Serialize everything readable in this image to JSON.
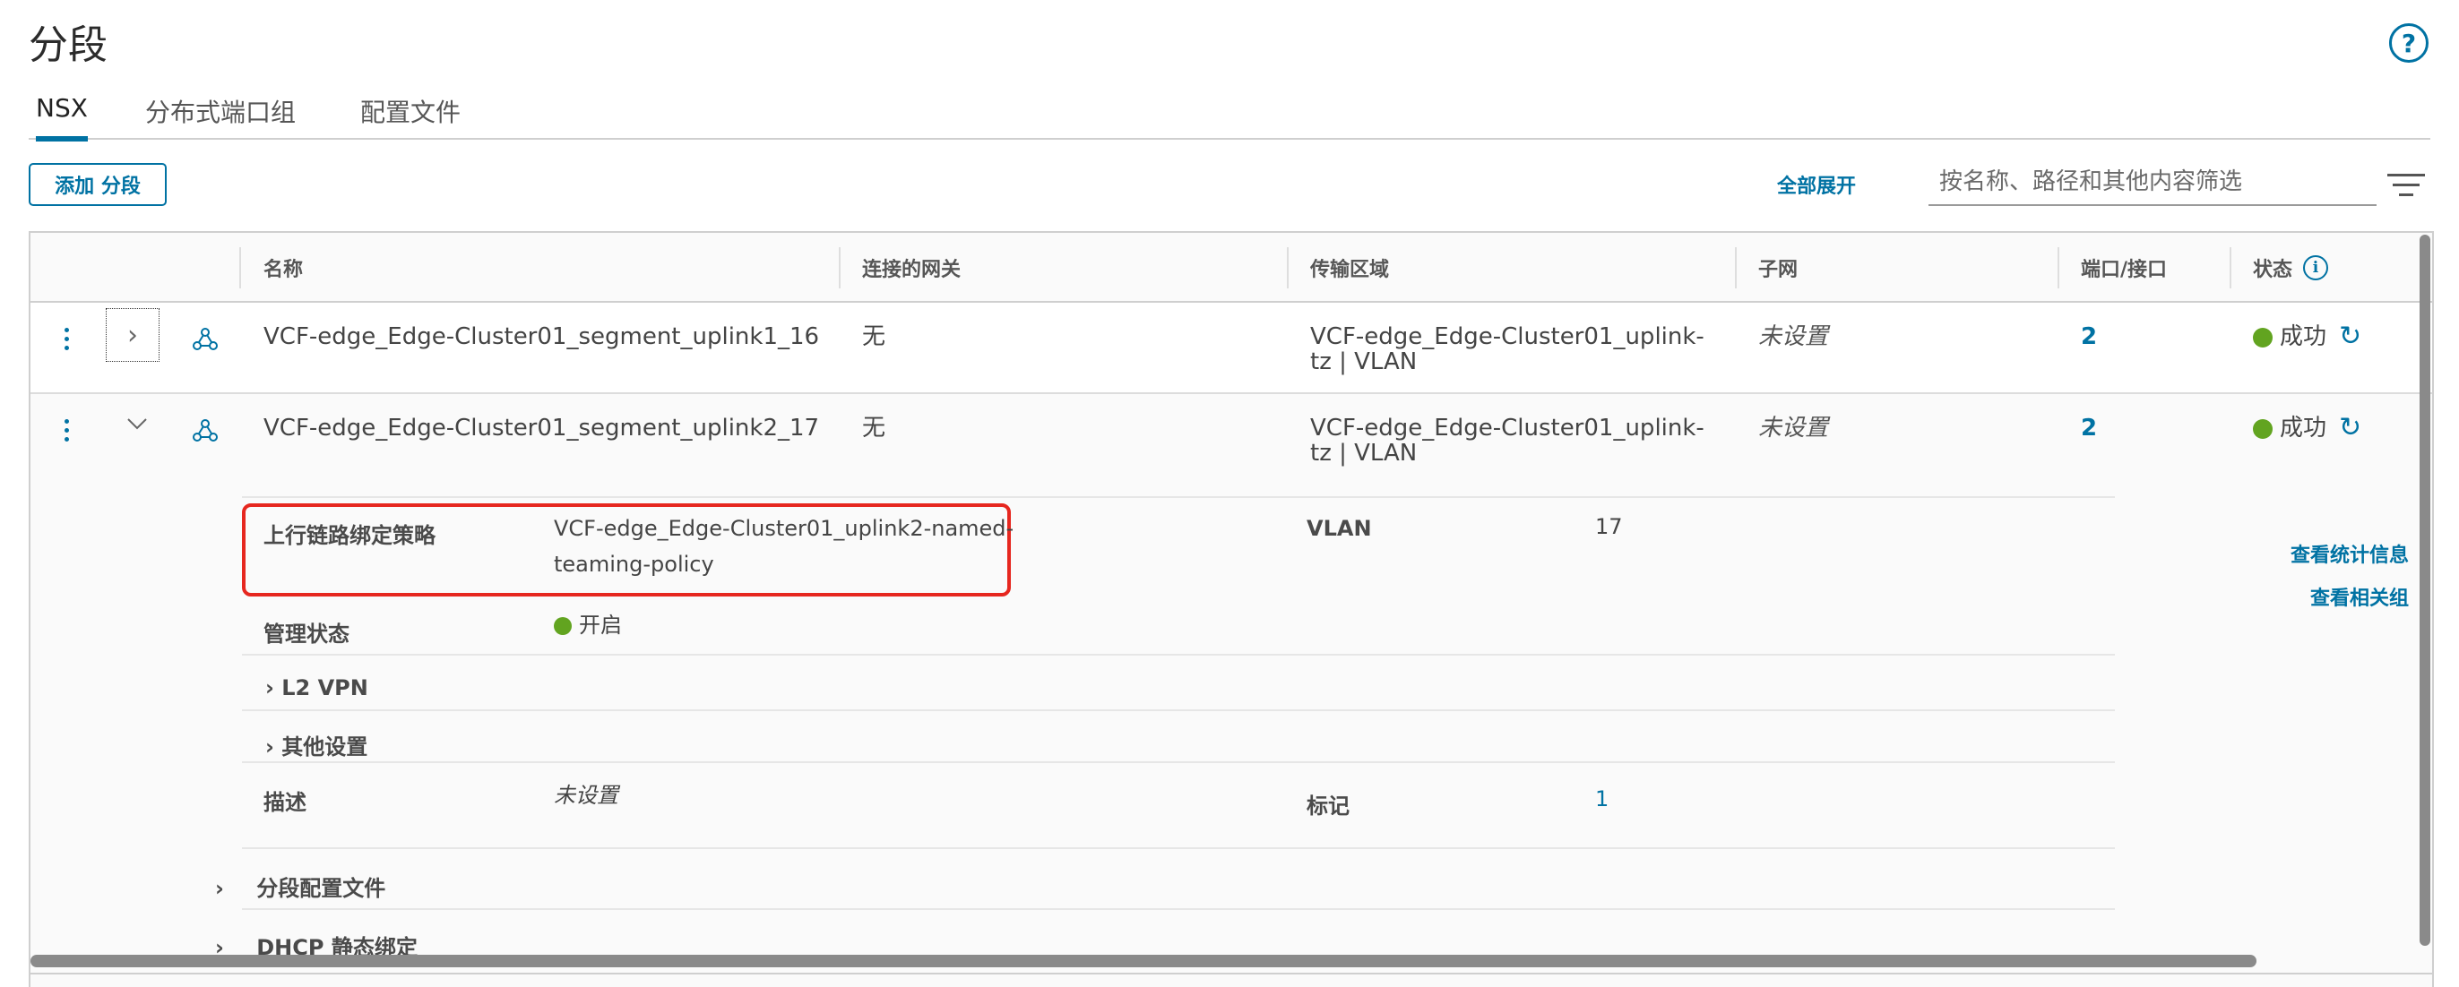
{
  "page": {
    "title": "分段",
    "help_icon": "help-circle-icon"
  },
  "tabs": [
    {
      "label": "NSX",
      "active": true
    },
    {
      "label": "分布式端口组",
      "active": false
    },
    {
      "label": "配置文件",
      "active": false
    }
  ],
  "toolbar": {
    "add_label": "添加 分段",
    "expand_all_label": "全部展开",
    "filter_placeholder": "按名称、路径和其他内容筛选",
    "filter_icon": "filter-lines-icon"
  },
  "columns": [
    "名称",
    "连接的网关",
    "传输区域",
    "子网",
    "端口/接口",
    "状态"
  ],
  "rows": [
    {
      "name": "VCF-edge_Edge-Cluster01_segment_uplink1_16",
      "gateway": "无",
      "transport_zone_line1": "VCF-edge_Edge-Cluster01_uplink-",
      "transport_zone_line2": "tz | VLAN",
      "subnet": "未设置",
      "ports": "2",
      "status": "成功",
      "expanded": false
    },
    {
      "name": "VCF-edge_Edge-Cluster01_segment_uplink2_17",
      "gateway": "无",
      "transport_zone_line1": "VCF-edge_Edge-Cluster01_uplink-",
      "transport_zone_line2": "tz | VLAN",
      "subnet": "未设置",
      "ports": "2",
      "status": "成功",
      "expanded": true
    }
  ],
  "details": {
    "teaming_label": "上行链路绑定策略",
    "teaming_value_line1": "VCF-edge_Edge-Cluster01_uplink2-named-",
    "teaming_value_line2": "teaming-policy",
    "vlan_label": "VLAN",
    "vlan_value": "17",
    "admin_state_label": "管理状态",
    "admin_state_value": "开启",
    "l2vpn_label": "L2 VPN",
    "other_settings_label": "其他设置",
    "description_label": "描述",
    "description_value": "未设置",
    "tags_label": "标记",
    "tags_value": "1",
    "view_stats_link": "查看统计信息",
    "view_groups_link": "查看相关组",
    "segment_profiles_label": "分段配置文件",
    "dhcp_static_label": "DHCP 静态绑定"
  },
  "colors": {
    "accent": "#0072a3",
    "success": "#62a420",
    "highlight": "#e6271f"
  }
}
